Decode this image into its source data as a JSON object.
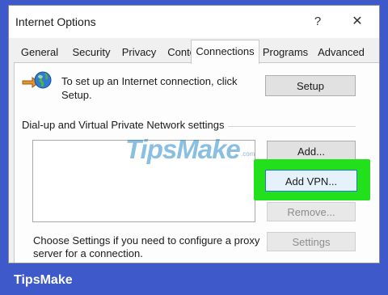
{
  "window": {
    "title": "Internet Options",
    "help": "?",
    "close": "✕"
  },
  "tabs": [
    {
      "label": "General"
    },
    {
      "label": "Security"
    },
    {
      "label": "Privacy"
    },
    {
      "label": "Content"
    },
    {
      "label": "Connections",
      "active": true
    },
    {
      "label": "Programs"
    },
    {
      "label": "Advanced"
    }
  ],
  "setup": {
    "description": "To set up an Internet connection, click Setup.",
    "button": "Setup"
  },
  "vpn_section": {
    "label": "Dial-up and Virtual Private Network settings",
    "add_button": "Add...",
    "add_vpn_button": "Add VPN...",
    "remove_button": "Remove..."
  },
  "proxy": {
    "description": "Choose Settings if you need to configure a proxy server for a connection.",
    "settings_button": "Settings"
  },
  "watermark": {
    "text": "TipsMake",
    "suffix": ".com"
  },
  "footer": {
    "brand": "TipsMake"
  },
  "colors": {
    "background": "#3e59c9",
    "highlight": "#22e01c",
    "dialog": "#f0f0f0"
  }
}
